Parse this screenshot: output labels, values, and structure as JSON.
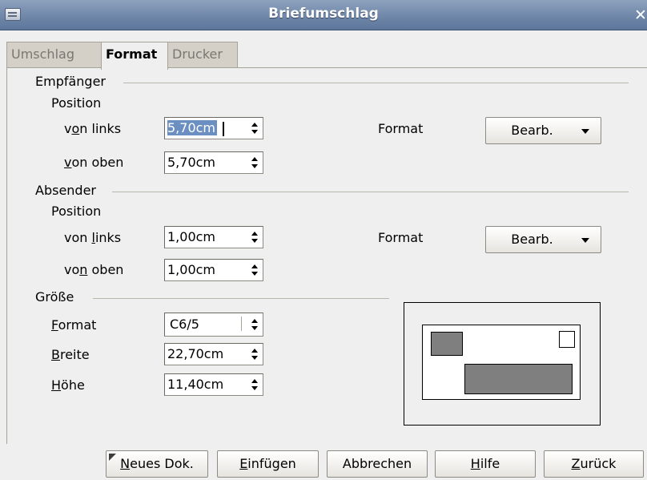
{
  "window": {
    "title": "Briefumschlag",
    "close_label": "✕"
  },
  "tabs": [
    {
      "label": "Umschlag",
      "active": false
    },
    {
      "label": "Format",
      "active": true
    },
    {
      "label": "Drucker",
      "active": false
    }
  ],
  "recipient": {
    "section": "Empfänger",
    "position_label": "Position",
    "left": {
      "label_pre": "v",
      "label_u": "o",
      "label_post": "n links",
      "value": "5,70cm"
    },
    "top": {
      "label_pre": "",
      "label_u": "v",
      "label_post": "on oben",
      "value": "5,70cm"
    },
    "format_label": "Format",
    "edit_button": "Bearb."
  },
  "sender": {
    "section": "Absender",
    "position_label": "Position",
    "left": {
      "label_pre": "von ",
      "label_u": "l",
      "label_post": "inks",
      "value": "1,00cm"
    },
    "top": {
      "label_pre": "vo",
      "label_u": "n",
      "label_post": " oben",
      "value": "1,00cm"
    },
    "format_label": "Format",
    "edit_button": "Bearb."
  },
  "size": {
    "section": "Größe",
    "format": {
      "label_u": "F",
      "label_post": "ormat",
      "value": "C6/5"
    },
    "width": {
      "label_u": "B",
      "label_post": "reite",
      "value": "22,70cm"
    },
    "height": {
      "label_u": "H",
      "label_post": "öhe",
      "value": "11,40cm"
    }
  },
  "buttons": {
    "new_doc": {
      "u": "N",
      "rest": "eues Dok."
    },
    "insert": {
      "u": "E",
      "rest": "infügen"
    },
    "cancel": {
      "label": "Abbrechen"
    },
    "help": {
      "u": "H",
      "rest": "ilfe"
    },
    "back": {
      "u": "Z",
      "rest": "urück"
    }
  }
}
